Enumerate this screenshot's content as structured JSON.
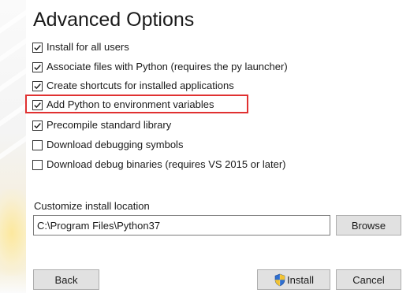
{
  "header": {
    "title": "Advanced Options"
  },
  "options": [
    {
      "label": "Install for all users",
      "checked": true
    },
    {
      "label": "Associate files with Python (requires the py launcher)",
      "checked": true
    },
    {
      "label": "Create shortcuts for installed applications",
      "checked": true
    },
    {
      "label": "Add Python to environment variables",
      "checked": true,
      "highlighted": true
    },
    {
      "label": "Precompile standard library",
      "checked": true
    },
    {
      "label": "Download debugging symbols",
      "checked": false
    },
    {
      "label": "Download debug binaries (requires VS 2015 or later)",
      "checked": false
    }
  ],
  "location": {
    "label": "Customize install location",
    "value": "C:\\Program Files\\Python37",
    "browse_label": "Browse"
  },
  "footer": {
    "back_label": "Back",
    "install_label": "Install",
    "cancel_label": "Cancel"
  },
  "colors": {
    "highlight_border": "#e03131",
    "button_face": "#e1e1e1",
    "shield_blue": "#2f6fd0",
    "shield_yellow": "#f2c230"
  },
  "icons": {
    "checkbox": "check-icon",
    "install": "shield-icon"
  }
}
